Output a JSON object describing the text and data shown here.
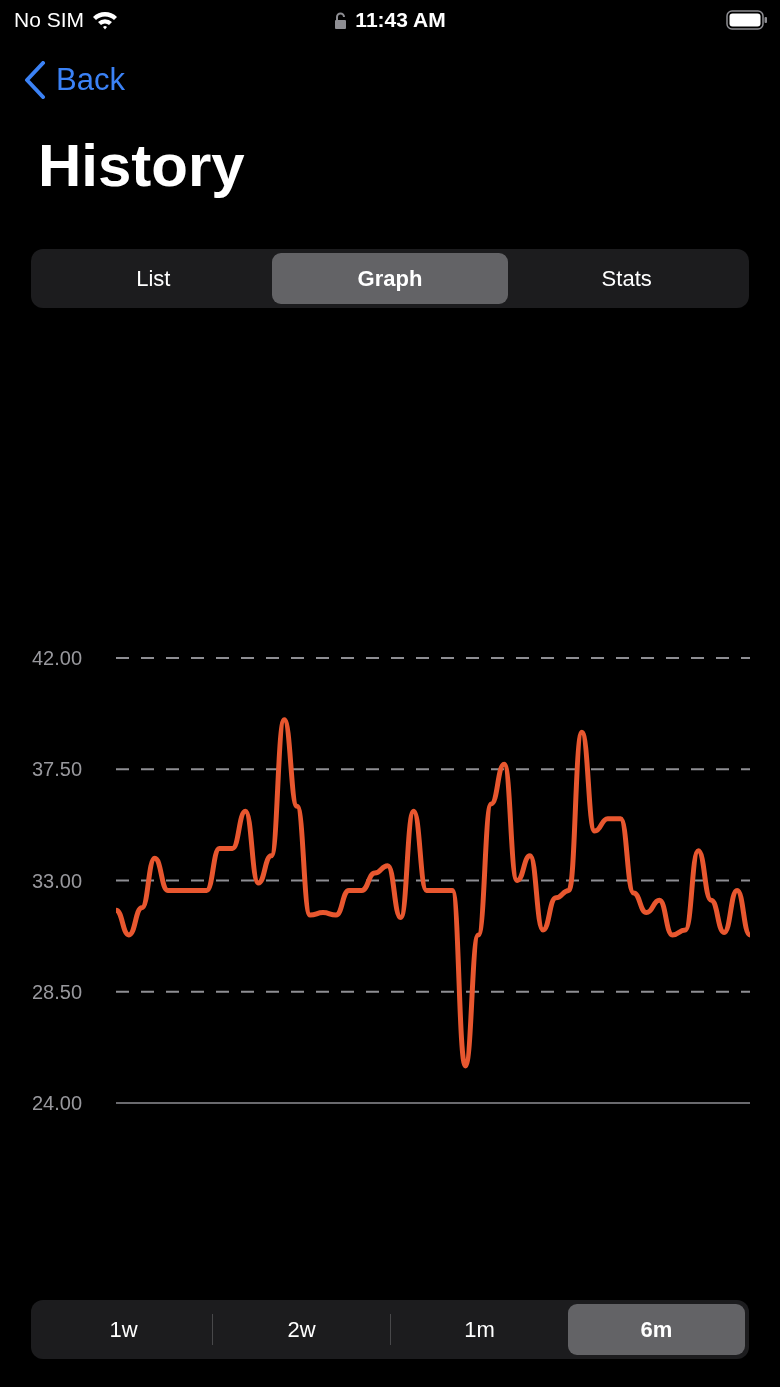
{
  "status_bar": {
    "carrier": "No SIM",
    "time": "11:43 AM"
  },
  "nav": {
    "back_label": "Back"
  },
  "title": "History",
  "view_tabs": [
    {
      "label": "List",
      "selected": false
    },
    {
      "label": "Graph",
      "selected": true
    },
    {
      "label": "Stats",
      "selected": false
    }
  ],
  "chart": {
    "chart_data": {
      "type": "line",
      "grid": true,
      "ylim": [
        24,
        42
      ],
      "yticks": [
        {
          "value": 24,
          "label": "24.00"
        },
        {
          "value": 28.5,
          "label": "28.50"
        },
        {
          "value": 33,
          "label": "33.00"
        },
        {
          "value": 37.5,
          "label": "37.50"
        },
        {
          "value": 42,
          "label": "42.00"
        }
      ],
      "series": [
        {
          "color": "#e8572f",
          "values": [
            31.8,
            30.8,
            31.9,
            33.9,
            32.6,
            32.6,
            32.6,
            32.6,
            34.3,
            34.3,
            35.8,
            32.9,
            34.0,
            39.5,
            36.0,
            31.6,
            31.7,
            31.6,
            32.6,
            32.6,
            33.3,
            33.6,
            31.5,
            35.8,
            32.6,
            32.6,
            32.6,
            25.5,
            30.8,
            36.1,
            37.7,
            33.0,
            34.0,
            31.0,
            32.3,
            32.6,
            39.0,
            35.0,
            35.5,
            35.5,
            32.5,
            31.7,
            32.2,
            30.8,
            31.0,
            34.2,
            32.2,
            30.9,
            32.6,
            30.8
          ]
        }
      ]
    }
  },
  "range_tabs": [
    {
      "label": "1w",
      "selected": false
    },
    {
      "label": "2w",
      "selected": false
    },
    {
      "label": "1m",
      "selected": false
    },
    {
      "label": "6m",
      "selected": true
    }
  ]
}
